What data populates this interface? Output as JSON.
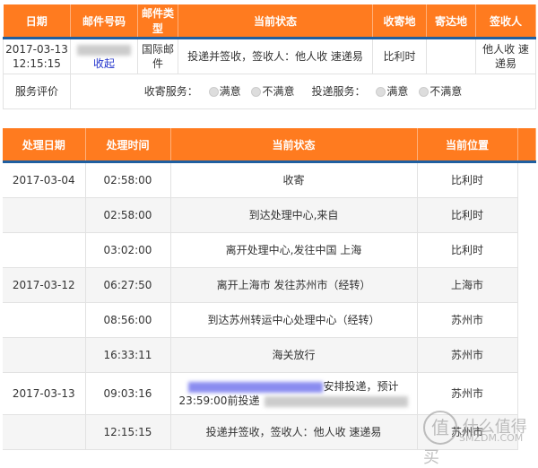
{
  "summary": {
    "headers": [
      "日期",
      "邮件号码",
      "邮件类型",
      "当前状态",
      "收寄地",
      "寄达地",
      "签收人"
    ],
    "row": {
      "date": "2017-03-13 12:15:15",
      "collapse_link": "收起",
      "type": "国际邮件",
      "status": "投递并签收，签收人：他人收 速递易",
      "origin": "比利时",
      "destination": "",
      "signer": "他人收 速递易"
    },
    "rating": {
      "label": "服务评价",
      "pickup_label": "收寄服务：",
      "delivery_label": "投递服务：",
      "satisfied": "满意",
      "unsatisfied": "不满意"
    }
  },
  "tracking": {
    "headers": [
      "处理日期",
      "处理时间",
      "当前状态",
      "当前位置"
    ],
    "rows": [
      {
        "date": "2017-03-04",
        "time": "02:58:00",
        "status": "收寄",
        "location": "比利时"
      },
      {
        "date": "",
        "time": "02:58:00",
        "status": "到达处理中心,来自",
        "location": "比利时"
      },
      {
        "date": "",
        "time": "03:02:00",
        "status": "离开处理中心,发往中国 上海",
        "location": "比利时"
      },
      {
        "date": "2017-03-12",
        "time": "06:27:50",
        "status": "离开上海市 发往苏州市（经转）",
        "location": "上海市"
      },
      {
        "date": "",
        "time": "08:56:00",
        "status": "到达苏州转运中心处理中心（经转）",
        "location": "苏州市"
      },
      {
        "date": "",
        "time": "16:33:11",
        "status": "海关放行",
        "location": "苏州市"
      },
      {
        "date": "2017-03-13",
        "time": "09:03:16",
        "status": "安排投递，预计",
        "status2": "23:59:00前投递",
        "location": "苏州市"
      },
      {
        "date": "",
        "time": "12:15:15",
        "status": "投递并签收，签收人：他人收 速递易",
        "location": "苏州市"
      }
    ]
  },
  "watermark": {
    "glyph": "值",
    "text": "什么值得买",
    "site": "SMZDM.COM"
  }
}
